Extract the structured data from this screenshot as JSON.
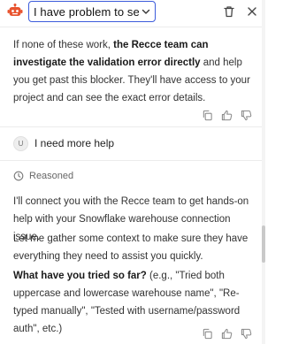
{
  "header": {
    "conversation_title": "I have problem to set...",
    "brand_color": "#e8542f",
    "icons": {
      "bot": "robot-icon",
      "dropdown": "chevron-down-icon",
      "delete": "trash-icon",
      "close": "close-icon"
    }
  },
  "messages": {
    "assistant_1": {
      "text_before": "If none of these work, ",
      "bold": "the Recce team can investigate the validation error directly",
      "text_after": " and help you get past this blocker. They'll have access to your project and can see the exact error details."
    },
    "user": {
      "avatar": "U",
      "text": "I need more help"
    },
    "assistant_2": {
      "reasoned_label": "Reasoned",
      "para_1": "I'll connect you with the Recce team to get hands-on help with your Snowflake warehouse connection issue.",
      "para_2": "Let me gather some context to make sure they have everything they need to assist you quickly.",
      "question_bold": "What have you tried so far?",
      "question_rest": " (e.g., \"Tried both uppercase and lowercase warehouse name\", \"Re-typed manually\", \"Tested with username/password auth\", etc.)"
    }
  },
  "message_actions": [
    "copy-icon",
    "thumbs-up-icon",
    "thumbs-down-icon"
  ]
}
